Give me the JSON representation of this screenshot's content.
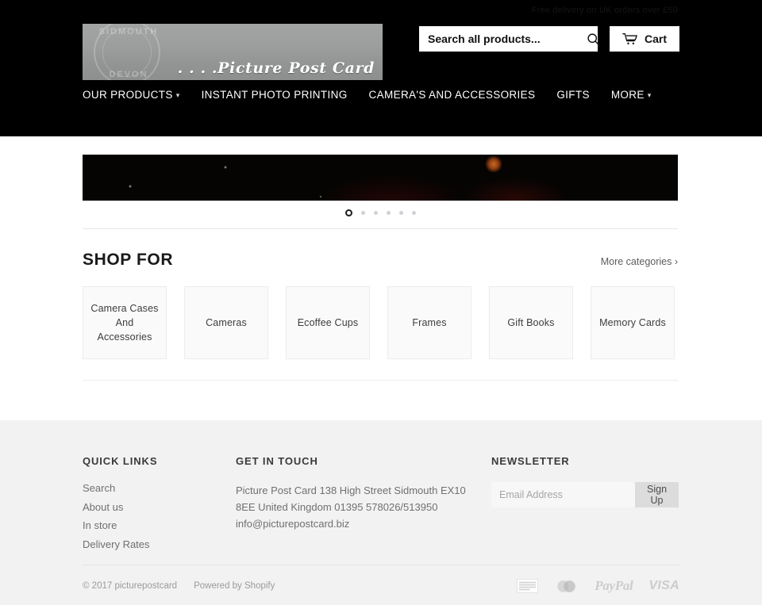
{
  "header": {
    "faint_note": "Free delivery on UK orders over £50",
    "logo": {
      "postmark_top": "SIDMOUTH",
      "postmark_bottom": "DEVON",
      "script_text": ". . . .Picture Post Card"
    },
    "search": {
      "placeholder": "Search all products...",
      "value": "",
      "icon": "search-icon"
    },
    "cart": {
      "label": "Cart",
      "icon": "shopping-cart-icon"
    },
    "nav": [
      {
        "label": "OUR PRODUCTS",
        "has_caret": true
      },
      {
        "label": "INSTANT PHOTO PRINTING",
        "has_caret": false
      },
      {
        "label": "CAMERA'S AND ACCESSORIES",
        "has_caret": false
      },
      {
        "label": "GIFTS",
        "has_caret": false
      },
      {
        "label": "MORE",
        "has_caret": true
      }
    ]
  },
  "slideshow": {
    "dot_count": 6,
    "active_index": 0
  },
  "shop_for": {
    "title": "SHOP FOR",
    "more_link": "More categories ›",
    "categories": [
      {
        "label": "Camera Cases And Accessories"
      },
      {
        "label": "Cameras"
      },
      {
        "label": "Ecoffee Cups"
      },
      {
        "label": "Frames"
      },
      {
        "label": "Gift Books"
      },
      {
        "label": "Memory Cards"
      }
    ]
  },
  "footer": {
    "quick_links": {
      "title": "QUICK LINKS",
      "items": [
        "Search",
        "About us",
        "In store",
        "Delivery Rates"
      ]
    },
    "get_in_touch": {
      "title": "GET IN TOUCH",
      "address": "Picture Post Card 138 High Street Sidmouth EX10 8EE United Kingdom 01395 578026/513950 info@picturepostcard.biz"
    },
    "newsletter": {
      "title": "NEWSLETTER",
      "placeholder": "Email Address",
      "value": "",
      "button": "Sign Up"
    },
    "bottom": {
      "copyright": "© 2017 picturepostcard",
      "powered_by": "Powered by Shopify",
      "payment_icons": [
        "american-express",
        "mastercard",
        "paypal",
        "visa"
      ],
      "paypal_text": "PayPal",
      "visa_text": "VISA"
    }
  },
  "colors": {
    "header_bg": "#000000",
    "page_bg": "#ffffff",
    "footer_bg": "#f2f2f2",
    "card_bg": "#fafafa",
    "accent": "#c86a26"
  }
}
